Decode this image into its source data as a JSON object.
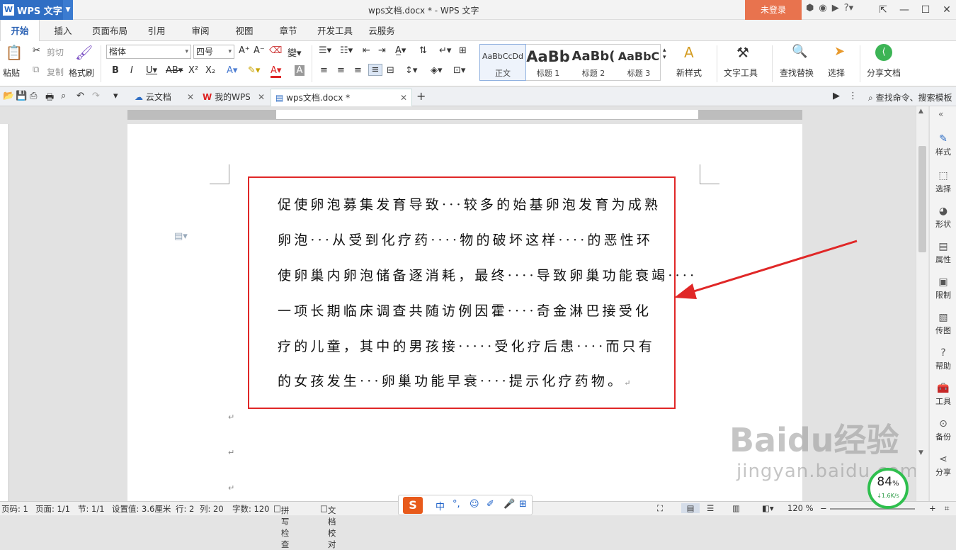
{
  "app": {
    "name": "WPS 文字",
    "window_title": "wps文档.docx * - WPS 文字",
    "login": "未登录"
  },
  "menu": {
    "tabs": [
      "开始",
      "插入",
      "页面布局",
      "引用",
      "审阅",
      "视图",
      "章节",
      "开发工具",
      "云服务"
    ]
  },
  "ribbon": {
    "paste": "粘贴",
    "cut": "剪切",
    "copy": "复制",
    "format_painter": "格式刷",
    "font": "楷体",
    "size": "四号",
    "styles": [
      {
        "preview": "AaBbCcDd",
        "name": "正文"
      },
      {
        "preview": "AaBb",
        "name": "标题 1"
      },
      {
        "preview": "AaBb(",
        "name": "标题 2"
      },
      {
        "preview": "AaBbC",
        "name": "标题 3"
      }
    ],
    "new_style": "新样式",
    "text_tools": "文字工具",
    "find_replace": "查找替换",
    "select": "选择",
    "share_doc": "分享文档"
  },
  "tabs": {
    "items": [
      {
        "label": "云文档"
      },
      {
        "label": "我的WPS"
      },
      {
        "label": "wps文档.docx *"
      }
    ],
    "search": "查找命令、搜索模板"
  },
  "document": {
    "lines": [
      "促使卵泡募集发育导致···较多的始基卵泡发育为成熟",
      "卵泡···从受到化疗药····物的破坏这样····的恶性环",
      "使卵巢内卵泡储备逐消耗，最终····导致卵巢功能衰竭····",
      "一项长期临床调查共随访例因霍····奇金淋巴接受化",
      "疗的儿童，其中的男孩接·····受化疗后患····而只有",
      "的女孩发生···卵巢功能早衰····提示化疗药物。"
    ],
    "end_mark": "↵"
  },
  "sidebar": {
    "items": [
      "样式",
      "选择",
      "形状",
      "属性",
      "限制",
      "传图",
      "帮助",
      "工具",
      "备份",
      "分享"
    ]
  },
  "status": {
    "page_no": "页码: 1",
    "pages": "页面: 1/1",
    "section": "节: 1/1",
    "setting": "设置值: 3.6厘米",
    "row": "行: 2",
    "col": "列: 20",
    "words": "字数: 120",
    "spell": "拼写检查",
    "proof": "文档校对",
    "zoom": "120 %"
  },
  "net_speed": {
    "percent": "84",
    "rate": "1.6K/s"
  },
  "watermark": {
    "text": "Baidu经验",
    "url": "jingyan.baidu.com"
  },
  "colors": {
    "accent": "#2f6ec4",
    "highlight_box": "#e02727",
    "login": "#e8734e"
  }
}
